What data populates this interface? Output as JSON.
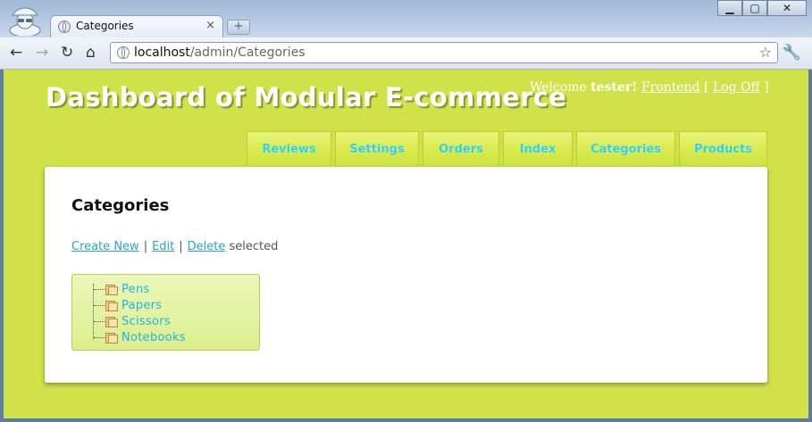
{
  "browser": {
    "tab_title": "Categories",
    "tab_close": "×",
    "new_tab": "+",
    "url_host": "localhost",
    "url_path": "/admin/Categories",
    "window_buttons": {
      "minimize": "▁",
      "maximize": "▢",
      "close": "✕"
    },
    "nav_icons": {
      "back": "←",
      "forward": "→",
      "reload": "↻",
      "home": "⌂",
      "star": "☆",
      "wrench": "🔧"
    }
  },
  "site": {
    "title": "Dashboard of Modular E-commerce",
    "welcome_text": "Welcome",
    "username": "tester!",
    "frontend_link": "Frontend",
    "bracket_open": "[",
    "logoff_link": "Log Off",
    "bracket_close": "]"
  },
  "menu": {
    "items": [
      {
        "label": "Reviews"
      },
      {
        "label": "Settings"
      },
      {
        "label": "Orders"
      },
      {
        "label": "Index"
      },
      {
        "label": "Categories"
      },
      {
        "label": "Products"
      }
    ]
  },
  "main": {
    "heading": "Categories",
    "actions": {
      "create_new": "Create New",
      "separator": "|",
      "edit": "Edit",
      "delete": "Delete",
      "selected_text": "selected"
    },
    "tree": {
      "items": [
        {
          "label": "Pens"
        },
        {
          "label": "Papers"
        },
        {
          "label": "Scissors"
        },
        {
          "label": "Notebooks"
        }
      ]
    }
  },
  "colors": {
    "page_background": "#d0e24a",
    "menu_text": "#2ad2f0",
    "link": "#2ba3c9",
    "tree_text": "#1fb6e0"
  }
}
